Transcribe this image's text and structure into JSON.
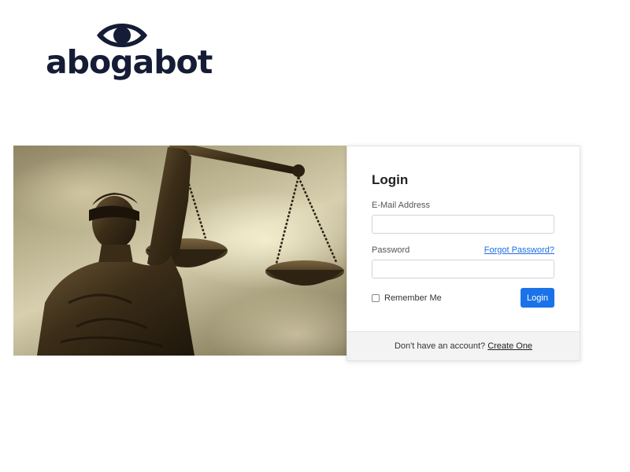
{
  "brand": {
    "name": "abogabot",
    "icon": "eye-icon",
    "color": "#141c36"
  },
  "hero": {
    "icon": "lady-justice-statue"
  },
  "login": {
    "title": "Login",
    "email_label": "E-Mail Address",
    "email_value": "",
    "password_label": "Password",
    "password_value": "",
    "forgot_link": "Forgot Password?",
    "remember_label": "Remember Me",
    "remember_checked": false,
    "submit_label": "Login",
    "accent_color": "#1a73e8"
  },
  "footer": {
    "prompt": "Don't have an account?",
    "link": "Create One"
  }
}
